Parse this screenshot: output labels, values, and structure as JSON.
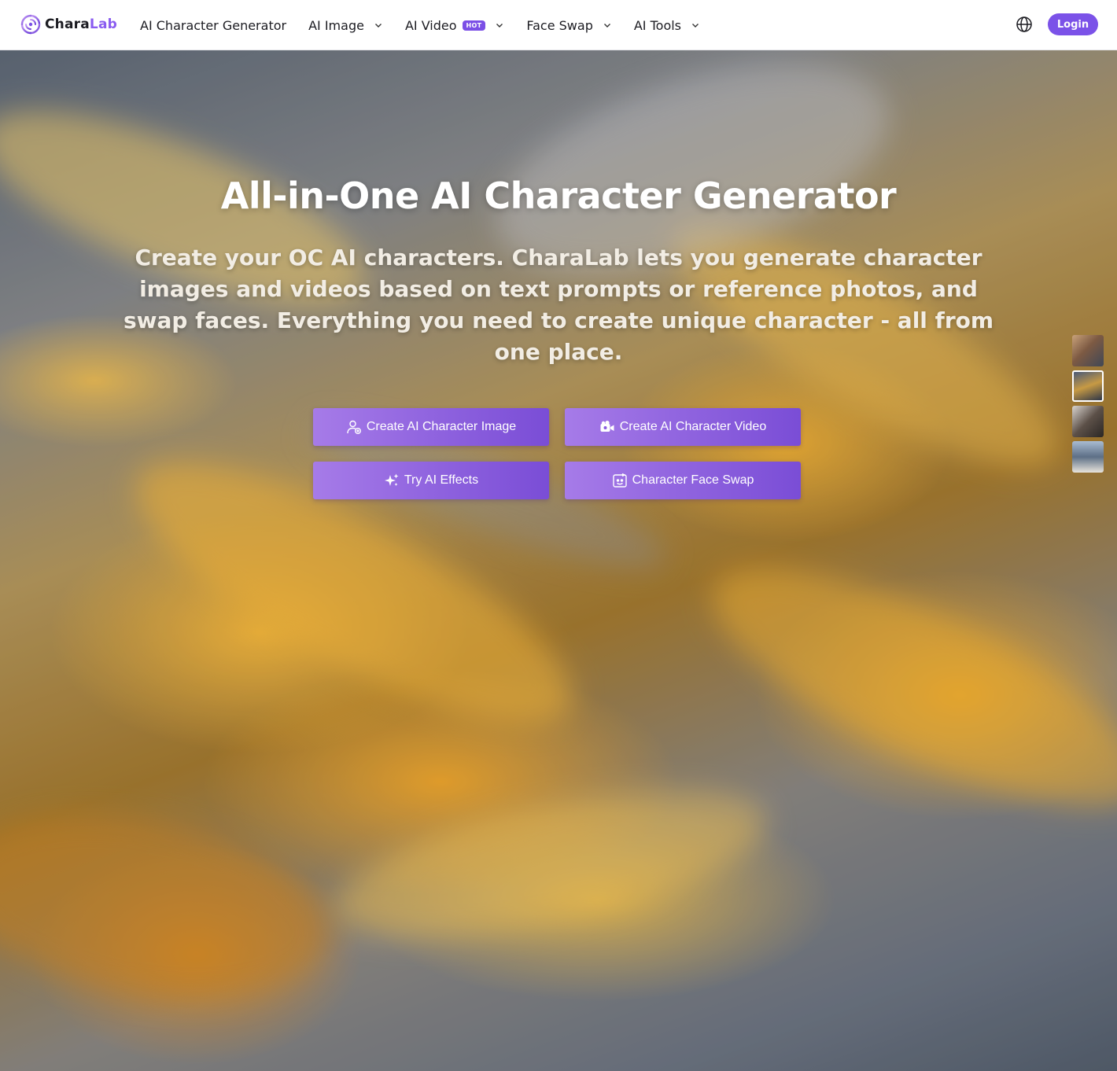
{
  "header": {
    "logo": {
      "text_main": "Chara",
      "text_accent": "Lab"
    },
    "nav": [
      {
        "label": "AI Character Generator",
        "dropdown": false
      },
      {
        "label": "AI Image",
        "dropdown": true
      },
      {
        "label": "AI Video",
        "dropdown": true,
        "badge": "HOT"
      },
      {
        "label": "Face Swap",
        "dropdown": true
      },
      {
        "label": "AI Tools",
        "dropdown": true
      }
    ],
    "language_icon": "globe-icon",
    "login_label": "Login"
  },
  "hero": {
    "title": "All-in-One AI Character Generator",
    "subtitle": "Create your OC AI characters. CharaLab lets you generate character images and videos based on text prompts or reference photos, and swap faces. Everything you need to create unique character - all from one place.",
    "buttons": [
      {
        "label": "Create AI Character Image",
        "icon": "user-sparkle-icon"
      },
      {
        "label": "Create AI Character Video",
        "icon": "video-camera-icon"
      },
      {
        "label": "Try AI Effects",
        "icon": "sparkles-icon"
      },
      {
        "label": "Character Face Swap",
        "icon": "face-swap-icon"
      }
    ],
    "thumbnails_count": 4,
    "active_thumbnail": 2
  },
  "colors": {
    "brand": "#7b52e8",
    "button_gradient_start": "#a67be8",
    "button_gradient_end": "#7a4dd6"
  }
}
